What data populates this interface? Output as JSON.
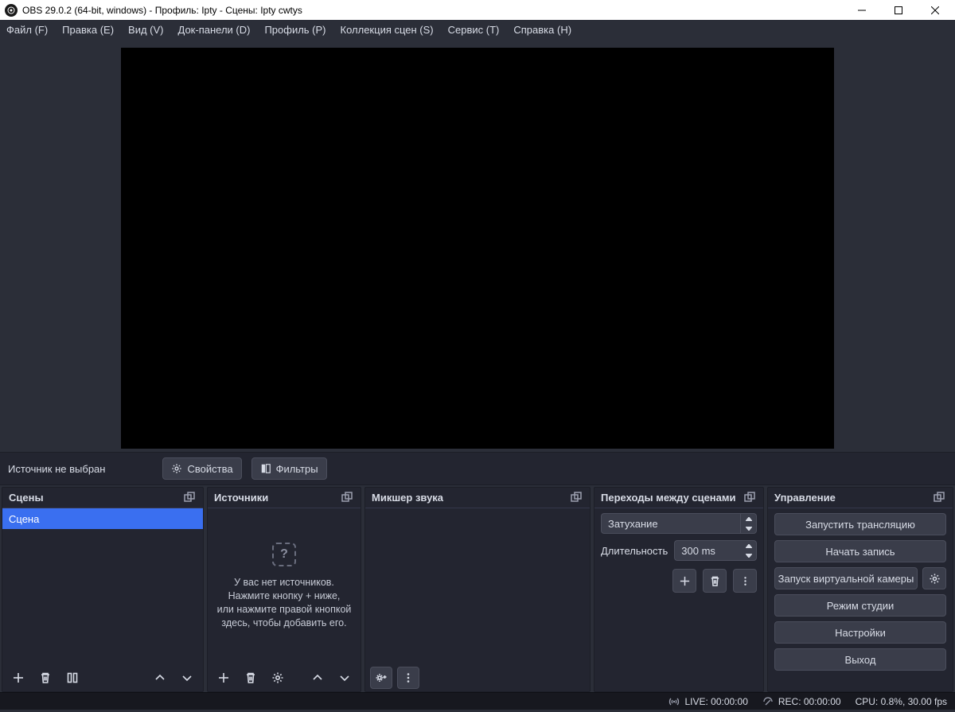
{
  "titlebar": {
    "title": "OBS 29.0.2 (64-bit, windows) - Профиль: Ipty - Сцены: Ipty cwtys"
  },
  "menu": {
    "file": "Файл (F)",
    "edit": "Правка (E)",
    "view": "Вид (V)",
    "docks": "Док-панели (D)",
    "profile": "Профиль (P)",
    "scene_collection": "Коллекция сцен (S)",
    "tools": "Сервис (T)",
    "help": "Справка (H)"
  },
  "source_toolbar": {
    "no_source": "Источник не выбран",
    "properties": "Свойства",
    "filters": "Фильтры"
  },
  "docks": {
    "scenes": {
      "title": "Сцены",
      "item": "Сцена"
    },
    "sources": {
      "title": "Источники",
      "empty_line1": "У вас нет источников.",
      "empty_line2": "Нажмите кнопку + ниже,",
      "empty_line3": "или нажмите правой кнопкой",
      "empty_line4": "здесь, чтобы добавить его."
    },
    "mixer": {
      "title": "Микшер звука"
    },
    "transitions": {
      "title": "Переходы между сценами",
      "selected": "Затухание",
      "duration_label": "Длительность",
      "duration_value": "300 ms"
    },
    "controls": {
      "title": "Управление",
      "start_stream": "Запустить трансляцию",
      "start_record": "Начать запись",
      "virtual_cam": "Запуск виртуальной камеры",
      "studio": "Режим студии",
      "settings": "Настройки",
      "exit": "Выход"
    }
  },
  "statusbar": {
    "live": "LIVE: 00:00:00",
    "rec": "REC: 00:00:00",
    "cpu": "CPU: 0.8%, 30.00 fps"
  }
}
